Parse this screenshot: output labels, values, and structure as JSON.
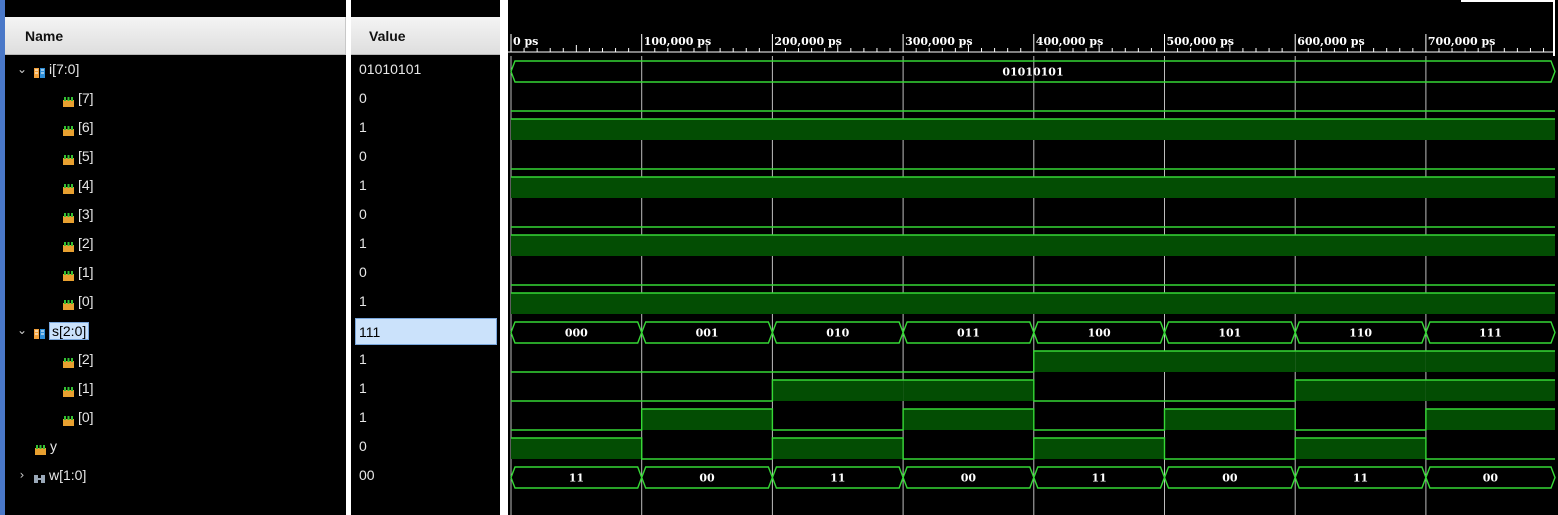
{
  "headers": {
    "name": "Name",
    "value": "Value"
  },
  "signals": [
    {
      "name": "i[7:0]",
      "value": "01010101",
      "kind": "bus",
      "expandable": true,
      "expanded": true,
      "indent": 0,
      "icon": "bus-signal-icon",
      "wave": {
        "type": "bus",
        "segments": [
          "01010101"
        ],
        "times": [
          0,
          800000
        ]
      }
    },
    {
      "name": "[7]",
      "value": "0",
      "kind": "bit",
      "indent": 1,
      "icon": "bit-signal-icon",
      "wave": {
        "type": "bit",
        "levels": [
          0
        ],
        "times": [
          0,
          800000
        ]
      }
    },
    {
      "name": "[6]",
      "value": "1",
      "kind": "bit",
      "indent": 1,
      "icon": "bit-signal-icon",
      "wave": {
        "type": "bit",
        "levels": [
          1
        ],
        "times": [
          0,
          800000
        ]
      }
    },
    {
      "name": "[5]",
      "value": "0",
      "kind": "bit",
      "indent": 1,
      "icon": "bit-signal-icon",
      "wave": {
        "type": "bit",
        "levels": [
          0
        ],
        "times": [
          0,
          800000
        ]
      }
    },
    {
      "name": "[4]",
      "value": "1",
      "kind": "bit",
      "indent": 1,
      "icon": "bit-signal-icon",
      "wave": {
        "type": "bit",
        "levels": [
          1
        ],
        "times": [
          0,
          800000
        ]
      }
    },
    {
      "name": "[3]",
      "value": "0",
      "kind": "bit",
      "indent": 1,
      "icon": "bit-signal-icon",
      "wave": {
        "type": "bit",
        "levels": [
          0
        ],
        "times": [
          0,
          800000
        ]
      }
    },
    {
      "name": "[2]",
      "value": "1",
      "kind": "bit",
      "indent": 1,
      "icon": "bit-signal-icon",
      "wave": {
        "type": "bit",
        "levels": [
          1
        ],
        "times": [
          0,
          800000
        ]
      }
    },
    {
      "name": "[1]",
      "value": "0",
      "kind": "bit",
      "indent": 1,
      "icon": "bit-signal-icon",
      "wave": {
        "type": "bit",
        "levels": [
          0
        ],
        "times": [
          0,
          800000
        ]
      }
    },
    {
      "name": "[0]",
      "value": "1",
      "kind": "bit",
      "indent": 1,
      "icon": "bit-signal-icon",
      "wave": {
        "type": "bit",
        "levels": [
          1
        ],
        "times": [
          0,
          800000
        ]
      }
    },
    {
      "name": "s[2:0]",
      "value": "111",
      "kind": "bus",
      "expandable": true,
      "expanded": true,
      "selected": true,
      "indent": 0,
      "icon": "bus-signal-icon",
      "wave": {
        "type": "bus",
        "segments": [
          "000",
          "001",
          "010",
          "011",
          "100",
          "101",
          "110",
          "111"
        ],
        "times": [
          0,
          100000,
          200000,
          300000,
          400000,
          500000,
          600000,
          700000,
          800000
        ]
      }
    },
    {
      "name": "[2]",
      "value": "1",
      "kind": "bit",
      "indent": 1,
      "icon": "bit-signal-icon",
      "wave": {
        "type": "bit",
        "levels": [
          0,
          0,
          0,
          0,
          1,
          1,
          1,
          1
        ],
        "times": [
          0,
          100000,
          200000,
          300000,
          400000,
          500000,
          600000,
          700000,
          800000
        ]
      }
    },
    {
      "name": "[1]",
      "value": "1",
      "kind": "bit",
      "indent": 1,
      "icon": "bit-signal-icon",
      "wave": {
        "type": "bit",
        "levels": [
          0,
          0,
          1,
          1,
          0,
          0,
          1,
          1
        ],
        "times": [
          0,
          100000,
          200000,
          300000,
          400000,
          500000,
          600000,
          700000,
          800000
        ]
      }
    },
    {
      "name": "[0]",
      "value": "1",
      "kind": "bit",
      "indent": 1,
      "icon": "bit-signal-icon",
      "wave": {
        "type": "bit",
        "levels": [
          0,
          1,
          0,
          1,
          0,
          1,
          0,
          1
        ],
        "times": [
          0,
          100000,
          200000,
          300000,
          400000,
          500000,
          600000,
          700000,
          800000
        ]
      }
    },
    {
      "name": "y",
      "value": "0",
      "kind": "bit",
      "indent": 0,
      "icon": "bit-signal-icon",
      "wave": {
        "type": "bit",
        "levels": [
          1,
          0,
          1,
          0,
          1,
          0,
          1,
          0
        ],
        "times": [
          0,
          100000,
          200000,
          300000,
          400000,
          500000,
          600000,
          700000,
          800000
        ]
      }
    },
    {
      "name": "w[1:0]",
      "value": "00",
      "kind": "bus",
      "expandable": true,
      "expanded": false,
      "indent": 0,
      "icon": "wire-bus-icon",
      "wave": {
        "type": "bus",
        "segments": [
          "11",
          "00",
          "11",
          "00",
          "11",
          "00",
          "11",
          "00"
        ],
        "times": [
          0,
          100000,
          200000,
          300000,
          400000,
          500000,
          600000,
          700000,
          800000
        ]
      }
    }
  ],
  "timeline": {
    "ticks": [
      {
        "label": "0 ps",
        "time": 0
      },
      {
        "label": "100,000 ps",
        "time": 100000
      },
      {
        "label": "200,000 ps",
        "time": 200000
      },
      {
        "label": "300,000 ps",
        "time": 300000
      },
      {
        "label": "400,000 ps",
        "time": 400000
      },
      {
        "label": "500,000 ps",
        "time": 500000
      },
      {
        "label": "600,000 ps",
        "time": 600000
      },
      {
        "label": "700,000 ps",
        "time": 700000
      }
    ],
    "visible_range_ps": [
      0,
      800000
    ]
  },
  "colors": {
    "wave_line": "#36d836",
    "wave_fill": "#034d03",
    "grid": "#bdbdbd",
    "background": "#000000",
    "selected_bg": "#cbe2fb"
  }
}
